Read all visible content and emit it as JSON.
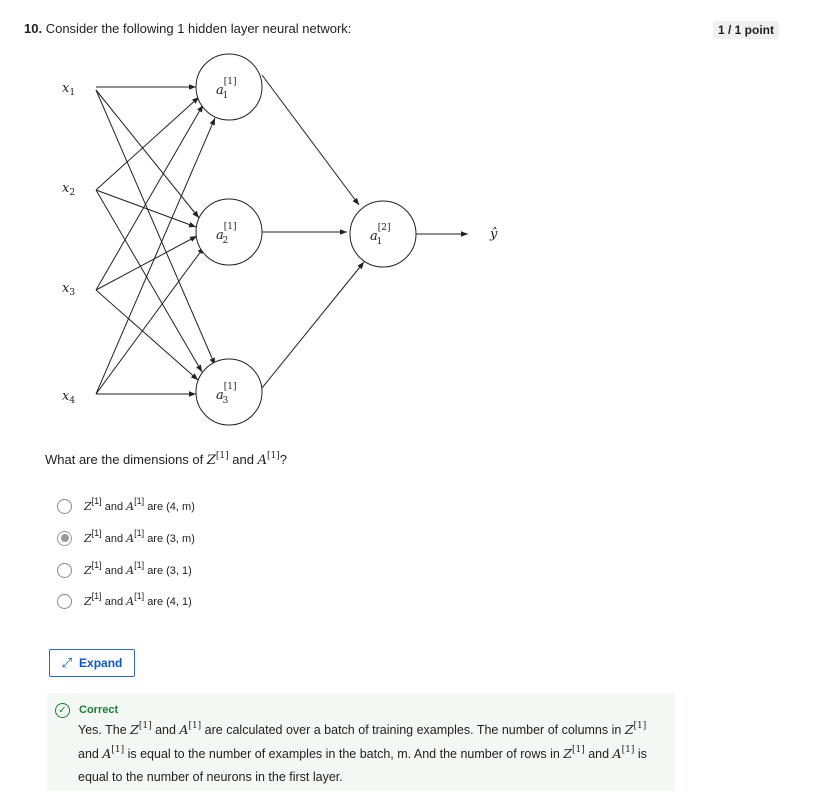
{
  "question": {
    "number": "10.",
    "text": "Consider the following 1 hidden layer neural network:",
    "points": "1 / 1 point"
  },
  "network": {
    "inputs": [
      "x1",
      "x2",
      "x3",
      "x4"
    ],
    "hidden": [
      "a1[1]",
      "a2[1]",
      "a3[1]"
    ],
    "output": "a1[2]",
    "prediction": "ŷ"
  },
  "prompt": {
    "before": "What are the dimensions of",
    "Z": "Z",
    "sup": "[1]",
    "and": "and",
    "A": "A",
    "end": "?"
  },
  "options": [
    {
      "Z": "Z",
      "sup": "[1]",
      "and": "and",
      "A": "A",
      "suffix": "are (4, m)",
      "selected": false
    },
    {
      "Z": "Z",
      "sup": "[1]",
      "and": "and",
      "A": "A",
      "suffix": "are (3, m)",
      "selected": true
    },
    {
      "Z": "Z",
      "sup": "[1]",
      "and": "and",
      "A": "A",
      "suffix": "are (3, 1)",
      "selected": false
    },
    {
      "Z": "Z",
      "sup": "[1]",
      "and": "and",
      "A": "A",
      "suffix": "are (4, 1)",
      "selected": false
    }
  ],
  "expand": {
    "label": "Expand",
    "icon": "expand-arrows-icon"
  },
  "feedback": {
    "status": "Correct",
    "icon": "check-circle-icon",
    "color": "#1a7f37",
    "t1": "Yes. The",
    "Z": "Z",
    "sup": "[1]",
    "t2": "and",
    "A": "A",
    "t3": "are calculated over a batch of training examples. The number of columns in",
    "t4": "and",
    "t5": "is equal to the number of examples in the batch, m. And the number of rows in",
    "t6": "and",
    "t7": "is equal to the number of neurons in the first layer."
  }
}
